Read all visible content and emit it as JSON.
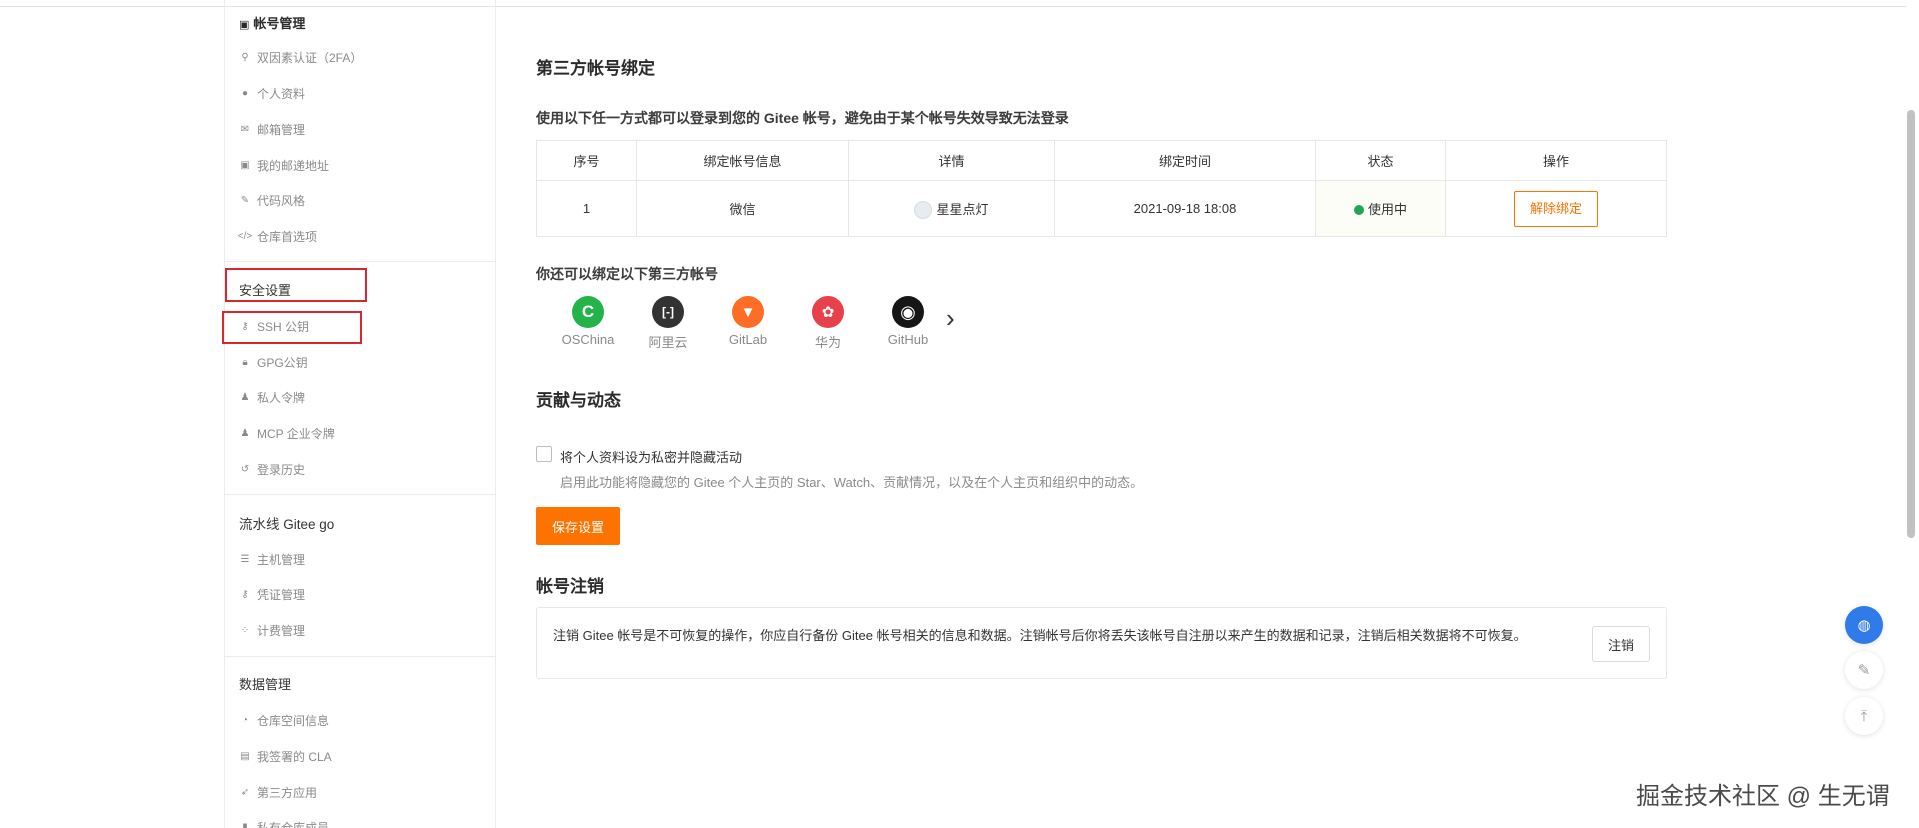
{
  "sidebar": {
    "account_section": "帐号管理",
    "account_items": [
      {
        "label": "双因素认证（2FA）",
        "icon": "user-key-icon"
      },
      {
        "label": "个人资料",
        "icon": "user-icon"
      },
      {
        "label": "邮箱管理",
        "icon": "mail-icon"
      },
      {
        "label": "我的邮递地址",
        "icon": "address-card-icon"
      },
      {
        "label": "代码风格",
        "icon": "brush-icon"
      },
      {
        "label": "仓库首选项",
        "icon": "code-icon"
      }
    ],
    "security_section": "安全设置",
    "security_items": [
      {
        "label": "SSH 公钥",
        "icon": "key-icon"
      },
      {
        "label": "GPG公钥",
        "icon": "lock-icon"
      },
      {
        "label": "私人令牌",
        "icon": "token-icon"
      },
      {
        "label": "MCP 企业令牌",
        "icon": "token-icon"
      },
      {
        "label": "登录历史",
        "icon": "history-icon"
      }
    ],
    "pipeline_section": "流水线 Gitee go",
    "pipeline_items": [
      {
        "label": "主机管理",
        "icon": "list-icon"
      },
      {
        "label": "凭证管理",
        "icon": "key-icon"
      },
      {
        "label": "计费管理",
        "icon": "billing-icon"
      }
    ],
    "data_section": "数据管理",
    "data_items": [
      {
        "label": "仓库空间信息",
        "icon": "pie-icon"
      },
      {
        "label": "我签署的 CLA",
        "icon": "document-icon"
      },
      {
        "label": "第三方应用",
        "icon": "rocket-icon"
      },
      {
        "label": "私有仓库成员",
        "icon": "members-icon"
      }
    ]
  },
  "main": {
    "binding_title": "第三方帐号绑定",
    "binding_subtitle": "使用以下任一方式都可以登录到您的 Gitee 帐号，避免由于某个帐号失效导致无法登录",
    "table": {
      "headers": [
        "序号",
        "绑定帐号信息",
        "详情",
        "绑定时间",
        "状态",
        "操作"
      ],
      "rows": [
        {
          "index": "1",
          "account": "微信",
          "detail": "星星点灯",
          "time": "2021-09-18 18:08",
          "status": "使用中",
          "action": "解除绑定"
        }
      ]
    },
    "more_title": "你还可以绑定以下第三方帐号",
    "providers": [
      {
        "name": "OSChina",
        "color": "#24b24b",
        "glyph": "C"
      },
      {
        "name": "阿里云",
        "color": "#333333",
        "glyph": "[-]"
      },
      {
        "name": "GitLab",
        "color": "#fc6d26",
        "glyph": "🦊"
      },
      {
        "name": "华为",
        "color": "#e8414b",
        "glyph": "✿"
      },
      {
        "name": "GitHub",
        "color": "#161616",
        "glyph": "●"
      }
    ],
    "contrib_title": "贡献与动态",
    "privacy_label": "将个人资料设为私密并隐藏活动",
    "privacy_desc": "启用此功能将隐藏您的 Gitee 个人主页的 Star、Watch、贡献情况，以及在个人主页和组织中的动态。",
    "save_label": "保存设置",
    "cancel_title": "帐号注销",
    "cancel_text": "注销 Gitee 帐号是不可恢复的操作，你应自行备份 Gitee 帐号相关的信息和数据。注销帐号后你将丢失该帐号自注册以来产生的数据和记录，注销后相关数据将不可恢复。",
    "cancel_button": "注销"
  },
  "watermark": "掘金技术社区 @ 生无谓",
  "colors": {
    "accent": "#fe7300",
    "status_green": "#21a659",
    "highlight_red": "#d9262f"
  }
}
